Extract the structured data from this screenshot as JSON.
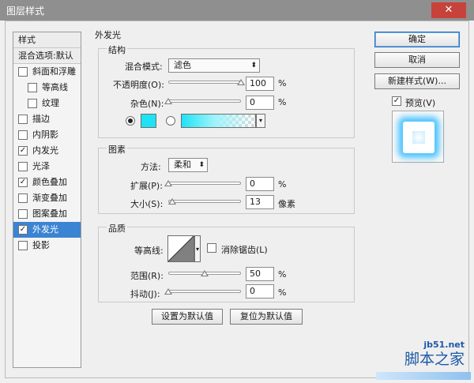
{
  "window": {
    "title": "图层样式",
    "close_glyph": "✕"
  },
  "style_list": {
    "header_1": "样式",
    "header_2": "混合选项:默认",
    "items": [
      {
        "label": "斜面和浮雕",
        "checked": false,
        "indent": false
      },
      {
        "label": "等高线",
        "checked": false,
        "indent": true
      },
      {
        "label": "纹理",
        "checked": false,
        "indent": true
      },
      {
        "label": "描边",
        "checked": false,
        "indent": false
      },
      {
        "label": "内阴影",
        "checked": false,
        "indent": false
      },
      {
        "label": "内发光",
        "checked": true,
        "indent": false
      },
      {
        "label": "光泽",
        "checked": false,
        "indent": false
      },
      {
        "label": "颜色叠加",
        "checked": true,
        "indent": false
      },
      {
        "label": "渐变叠加",
        "checked": false,
        "indent": false
      },
      {
        "label": "图案叠加",
        "checked": false,
        "indent": false
      },
      {
        "label": "外发光",
        "checked": true,
        "indent": false,
        "selected": true
      },
      {
        "label": "投影",
        "checked": false,
        "indent": false
      }
    ]
  },
  "outer_glow": {
    "title": "外发光",
    "structure": {
      "title": "结构",
      "blend_mode_label": "混合模式:",
      "blend_mode_value": "滤色",
      "opacity_label": "不透明度(O):",
      "opacity_value": "100",
      "opacity_fraction": 1.0,
      "noise_label": "杂色(N):",
      "noise_value": "0",
      "noise_fraction": 0.0,
      "percent": "%",
      "color_mode": "solid",
      "glow_color": "#1fe3f5"
    },
    "elements": {
      "title": "图素",
      "technique_label": "方法:",
      "technique_value": "柔和",
      "spread_label": "扩展(P):",
      "spread_value": "0",
      "spread_fraction": 0.0,
      "size_label": "大小(S):",
      "size_value": "13",
      "size_fraction": 0.05,
      "percent": "%",
      "size_unit": "像素"
    },
    "quality": {
      "title": "品质",
      "contour_label": "等高线:",
      "anti_alias_label": "消除锯齿(L)",
      "anti_alias_checked": false,
      "range_label": "范围(R):",
      "range_value": "50",
      "range_fraction": 0.5,
      "jitter_label": "抖动(J):",
      "jitter_value": "0",
      "jitter_fraction": 0.0,
      "percent": "%"
    },
    "make_default_label": "设置为默认值",
    "reset_default_label": "复位为默认值"
  },
  "buttons": {
    "ok": "确定",
    "cancel": "取消",
    "new_style": "新建样式(W)...",
    "preview_label": "预览(V)",
    "preview_checked": true
  },
  "watermark": {
    "url": "jb51.net",
    "name": "脚本之家"
  },
  "colors": {
    "accent": "#3b84d3",
    "glow": "#1fe3f5"
  }
}
